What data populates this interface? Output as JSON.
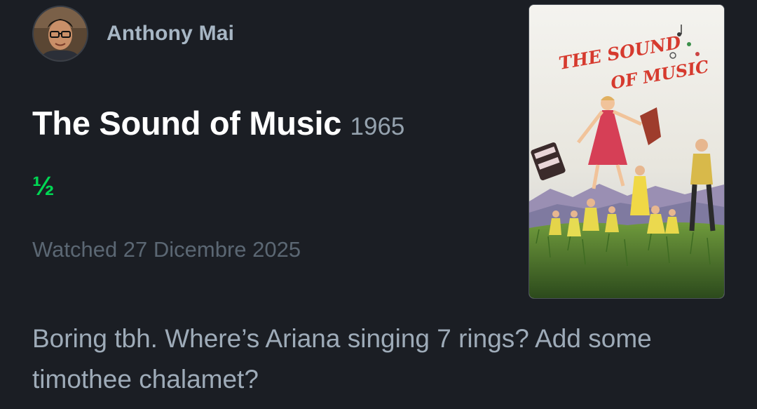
{
  "author": {
    "name": "Anthony Mai"
  },
  "film": {
    "title": "The Sound of Music",
    "year": "1965",
    "rating": "½",
    "watched": "Watched 27 Dicembre 2025"
  },
  "review": {
    "text": "Boring tbh. Where’s Ariana singing 7 rings? Add some timothee chalamet?"
  },
  "poster": {
    "title_line1": "THE SOUND",
    "title_line2": "OF MUSIC"
  },
  "colors": {
    "background": "#1b1e24",
    "rating_green": "#00d653",
    "author_name": "#a7b6c4",
    "muted_text": "#5b6773"
  }
}
